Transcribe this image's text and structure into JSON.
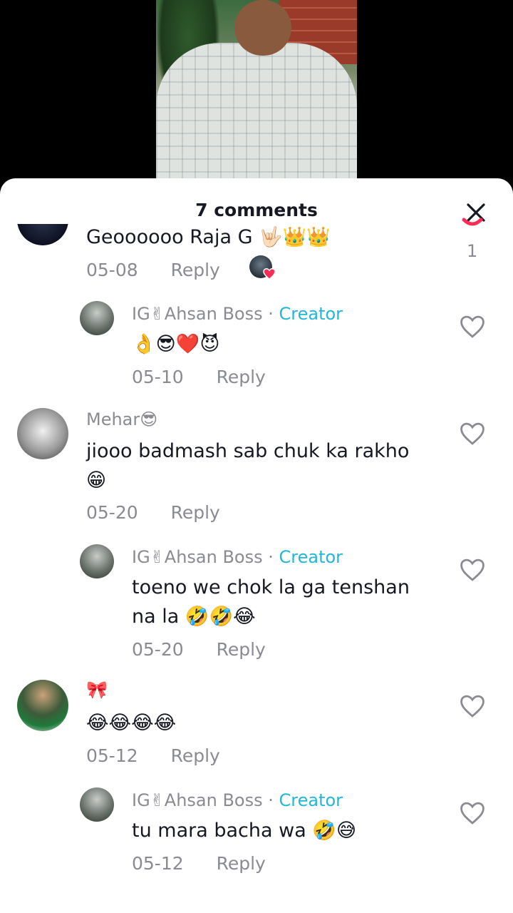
{
  "header": {
    "title": "7 comments"
  },
  "comments": [
    {
      "text": "Geoooooo Raja G 🤟🏻👑👑",
      "date": "05-08",
      "reply_label": "Reply",
      "like_count": "1"
    },
    {
      "username": "IG✌Ahsan Boss",
      "creator_label": "Creator",
      "text": "👌😎❤️😈",
      "date": "05-10",
      "reply_label": "Reply"
    },
    {
      "username": "Mehar😎",
      "text_line1": "jiooo badmash sab chuk ka rakho",
      "text_line2": "😁",
      "date": "05-20",
      "reply_label": "Reply"
    },
    {
      "username": "IG✌Ahsan Boss",
      "creator_label": "Creator",
      "text_line1": "toeno we chok la ga tenshan",
      "text_line2": "na la 🤣🤣😂",
      "date": "05-20",
      "reply_label": "Reply"
    },
    {
      "username": "🎀",
      "text": "😂😂😂😂",
      "date": "05-12",
      "reply_label": "Reply"
    },
    {
      "username": "IG✌Ahsan Boss",
      "creator_label": "Creator",
      "text": "tu mara bacha wa 🤣😅",
      "date": "05-12",
      "reply_label": "Reply"
    }
  ],
  "colors": {
    "creator": "#1fb8d9",
    "liked": "#fe2c55",
    "muted": "#8a8b91"
  }
}
